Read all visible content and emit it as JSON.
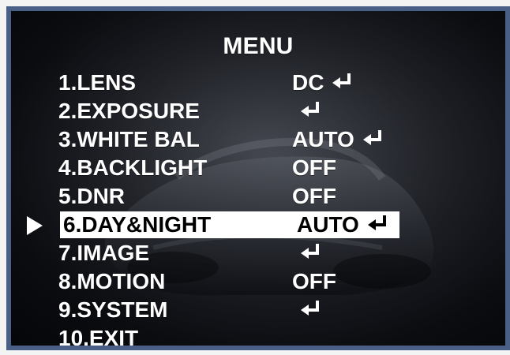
{
  "menu": {
    "title": "MENU",
    "items": [
      {
        "label": "1.LENS",
        "value": "DC",
        "has_enter": true,
        "selected": false
      },
      {
        "label": "2.EXPOSURE",
        "value": "",
        "has_enter": true,
        "selected": false
      },
      {
        "label": "3.WHITE BAL",
        "value": "AUTO",
        "has_enter": true,
        "selected": false
      },
      {
        "label": "4.BACKLIGHT",
        "value": "OFF",
        "has_enter": false,
        "selected": false
      },
      {
        "label": "5.DNR",
        "value": "OFF",
        "has_enter": false,
        "selected": false
      },
      {
        "label": "6.DAY&NIGHT",
        "value": "AUTO",
        "has_enter": true,
        "selected": true
      },
      {
        "label": "7.IMAGE",
        "value": "",
        "has_enter": true,
        "selected": false
      },
      {
        "label": "8.MOTION",
        "value": "OFF",
        "has_enter": false,
        "selected": false
      },
      {
        "label": "9.SYSTEM",
        "value": "",
        "has_enter": true,
        "selected": false
      },
      {
        "label": "10.EXIT",
        "value": "",
        "has_enter": false,
        "selected": false
      }
    ]
  },
  "icons": {
    "enter": "enter-return-icon",
    "selector": "right-triangle-cursor-icon"
  },
  "colors": {
    "frame_border": "#4a5f86",
    "menu_text": "#ffffff",
    "selection_bg": "#ffffff",
    "selection_text": "#000000"
  }
}
